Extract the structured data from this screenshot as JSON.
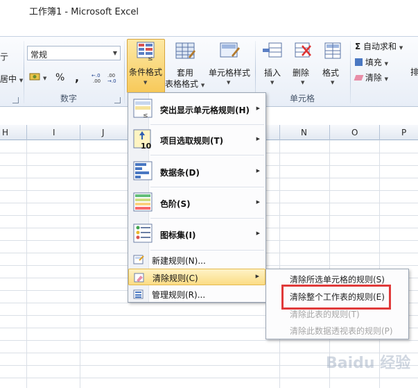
{
  "window": {
    "title": "工作簿1  -  Microsoft Excel"
  },
  "ribbon": {
    "align_fragment_top": "亍",
    "align_fragment_bottom": "居中",
    "number_format_value": "常规",
    "currency_symbol": "%",
    "comma_symbol": ",",
    "increase_decimal": "←.0\n.00",
    "decrease_decimal": ".00\n→.0",
    "group_number": "数字",
    "btn_conditional_format": "条件格式",
    "btn_table_format_line1": "套用",
    "btn_table_format_line2": "表格格式",
    "btn_cell_styles": "单元格样式",
    "btn_insert": "插入",
    "btn_delete": "删除",
    "btn_format": "格式",
    "group_cells": "单元格",
    "autosum": "自动求和",
    "fill": "填充",
    "clear": "清除",
    "sort_fragment": "排"
  },
  "sheet": {
    "columns": [
      "H",
      "I",
      "J",
      "N",
      "O",
      "P"
    ]
  },
  "menu": {
    "items": [
      {
        "label": "突出显示单元格规则(H)",
        "icon": "highlight-rules-icon"
      },
      {
        "label": "项目选取规则(T)",
        "icon": "top-bottom-rules-icon"
      },
      {
        "label": "数据条(D)",
        "icon": "data-bars-icon"
      },
      {
        "label": "色阶(S)",
        "icon": "color-scales-icon"
      },
      {
        "label": "图标集(I)",
        "icon": "icon-sets-icon"
      }
    ],
    "new_rule": "新建规则(N)...",
    "clear_rules": "清除规则(C)",
    "manage_rules": "管理规则(R)..."
  },
  "submenu": {
    "items": [
      {
        "label": "清除所选单元格的规则(S)",
        "enabled": true
      },
      {
        "label": "清除整个工作表的规则(E)",
        "enabled": true
      },
      {
        "label": "清除此表的规则(T)",
        "enabled": false
      },
      {
        "label": "清除此数据透视表的规则(P)",
        "enabled": false
      }
    ]
  },
  "watermark": "Baidu 经验",
  "colors": {
    "highlight": "#e03a3a",
    "menu_hover": "#fbdc84",
    "ribbon": "#e8eef7"
  }
}
